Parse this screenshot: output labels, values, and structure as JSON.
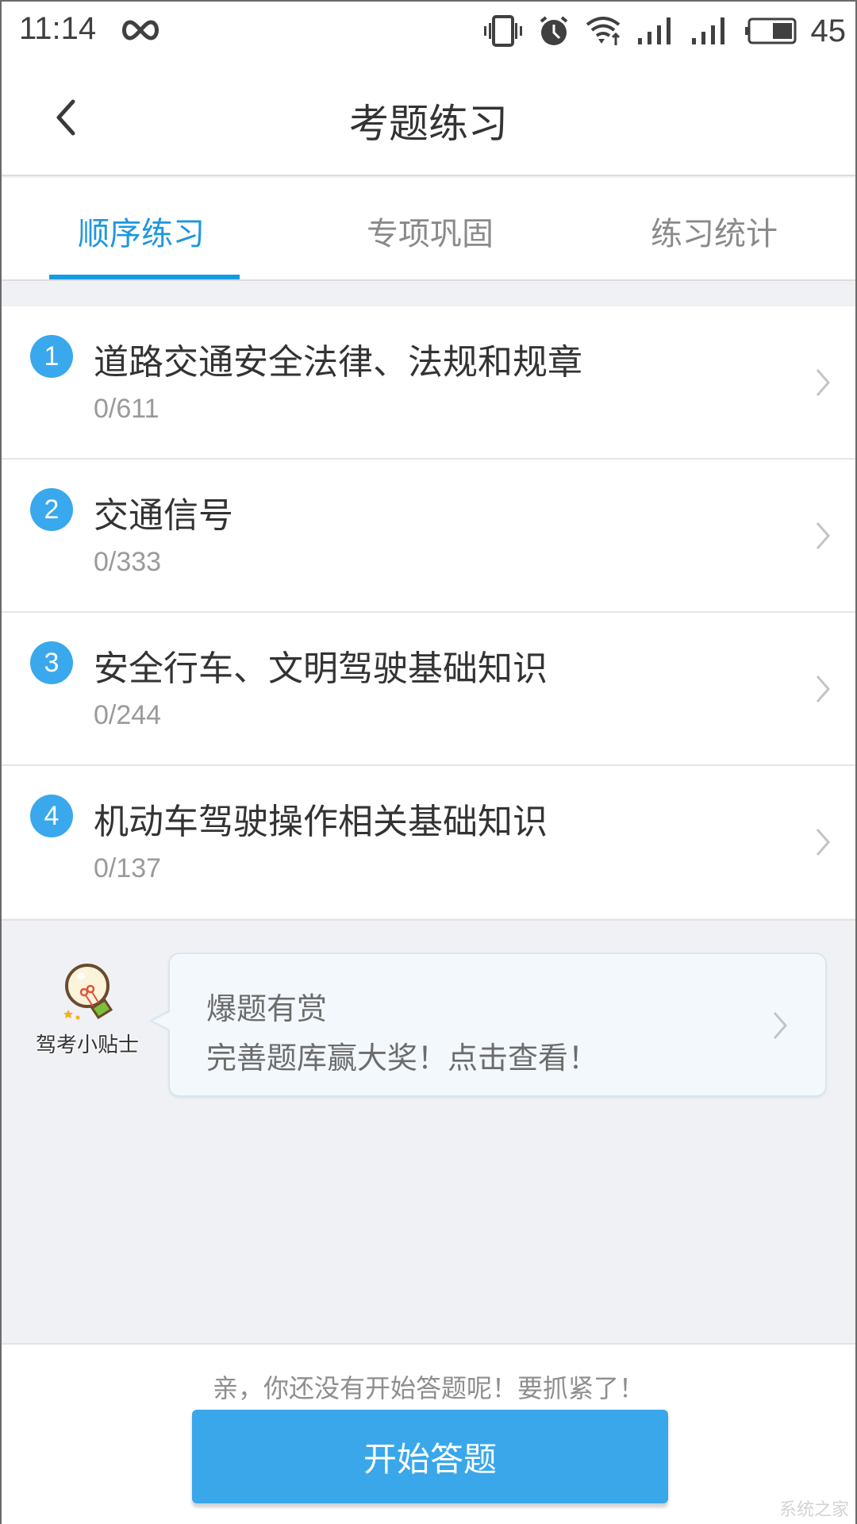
{
  "status_bar": {
    "time": "11:14",
    "icons": [
      "infinity-icon",
      "vibrate-icon",
      "alarm-icon",
      "wifi-icon",
      "signal-icon",
      "signal-icon",
      "battery-icon"
    ],
    "battery_level": "45"
  },
  "header": {
    "title": "考题练习",
    "back_icon": "chevron-left-icon"
  },
  "tabs": [
    {
      "label": "顺序练习",
      "active": true
    },
    {
      "label": "专项巩固",
      "active": false
    },
    {
      "label": "练习统计",
      "active": false
    }
  ],
  "chapters": [
    {
      "number": "1",
      "title": "道路交通安全法律、法规和规章",
      "progress": "0/611"
    },
    {
      "number": "2",
      "title": "交通信号",
      "progress": "0/333"
    },
    {
      "number": "3",
      "title": "安全行车、文明驾驶基础知识",
      "progress": "0/244"
    },
    {
      "number": "4",
      "title": "机动车驾驶操作相关基础知识",
      "progress": "0/137"
    }
  ],
  "tip": {
    "avatar_label": "驾考小贴士",
    "title": "爆题有赏",
    "text": "完善题库赢大奖！点击查看！"
  },
  "footer": {
    "hint": "亲，你还没有开始答题呢！要抓紧了！",
    "start_button": "开始答题"
  },
  "watermark": "系统之家",
  "colors": {
    "accent": "#3aa8ec",
    "tab_active": "#1d97e0",
    "button": "#39a7ea"
  }
}
